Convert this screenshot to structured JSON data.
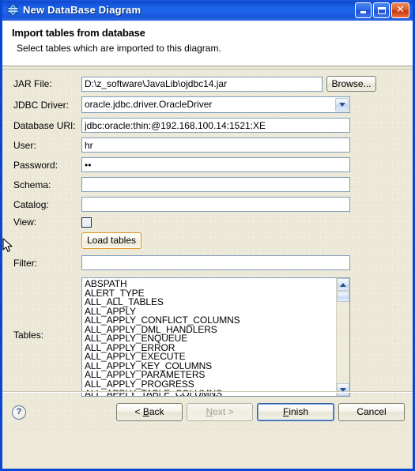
{
  "window": {
    "title": "New DataBase Diagram",
    "app_icon": "globe-icon",
    "minimize_label": "Minimize",
    "maximize_label": "Maximize",
    "close_label": "Close"
  },
  "banner": {
    "heading": "Import tables from database",
    "description": "Select tables which are imported to this diagram."
  },
  "form": {
    "jar_file": {
      "label": "JAR File:",
      "value": "D:\\z_software\\JavaLib\\ojdbc14.jar",
      "browse_label": "Browse..."
    },
    "jdbc_driver": {
      "label": "JDBC Driver:",
      "value": "oracle.jdbc.driver.OracleDriver"
    },
    "database_uri": {
      "label": "Database URI:",
      "value": "jdbc:oracle:thin:@192.168.100.14:1521:XE"
    },
    "user": {
      "label": "User:",
      "value": "hr"
    },
    "password": {
      "label": "Password:",
      "value": "••"
    },
    "schema": {
      "label": "Schema:",
      "value": ""
    },
    "catalog": {
      "label": "Catalog:",
      "value": ""
    },
    "view": {
      "label": "View:",
      "checked": false
    },
    "load_tables": {
      "label": "Load tables",
      "state": "hover"
    },
    "filter": {
      "label": "Filter:",
      "value": ""
    },
    "tables": {
      "label": "Tables:",
      "items": [
        "ABSPATH",
        "ALERT_TYPE",
        "ALL_ALL_TABLES",
        "ALL_APPLY",
        "ALL_APPLY_CONFLICT_COLUMNS",
        "ALL_APPLY_DML_HANDLERS",
        "ALL_APPLY_ENQUEUE",
        "ALL_APPLY_ERROR",
        "ALL_APPLY_EXECUTE",
        "ALL_APPLY_KEY_COLUMNS",
        "ALL_APPLY_PARAMETERS",
        "ALL_APPLY_PROGRESS",
        "ALL_APPLY_TABLE_COLUMNS"
      ]
    }
  },
  "footer": {
    "help_label": "?",
    "back_label": "< Back",
    "next_label": "Next >",
    "finish_label": "Finish",
    "cancel_label": "Cancel"
  },
  "colors": {
    "titlebar_blue": "#1B5CE0",
    "dialog_beige": "#ECE9D8",
    "field_border": "#7F9DB9",
    "hover_orange": "#E09422"
  }
}
